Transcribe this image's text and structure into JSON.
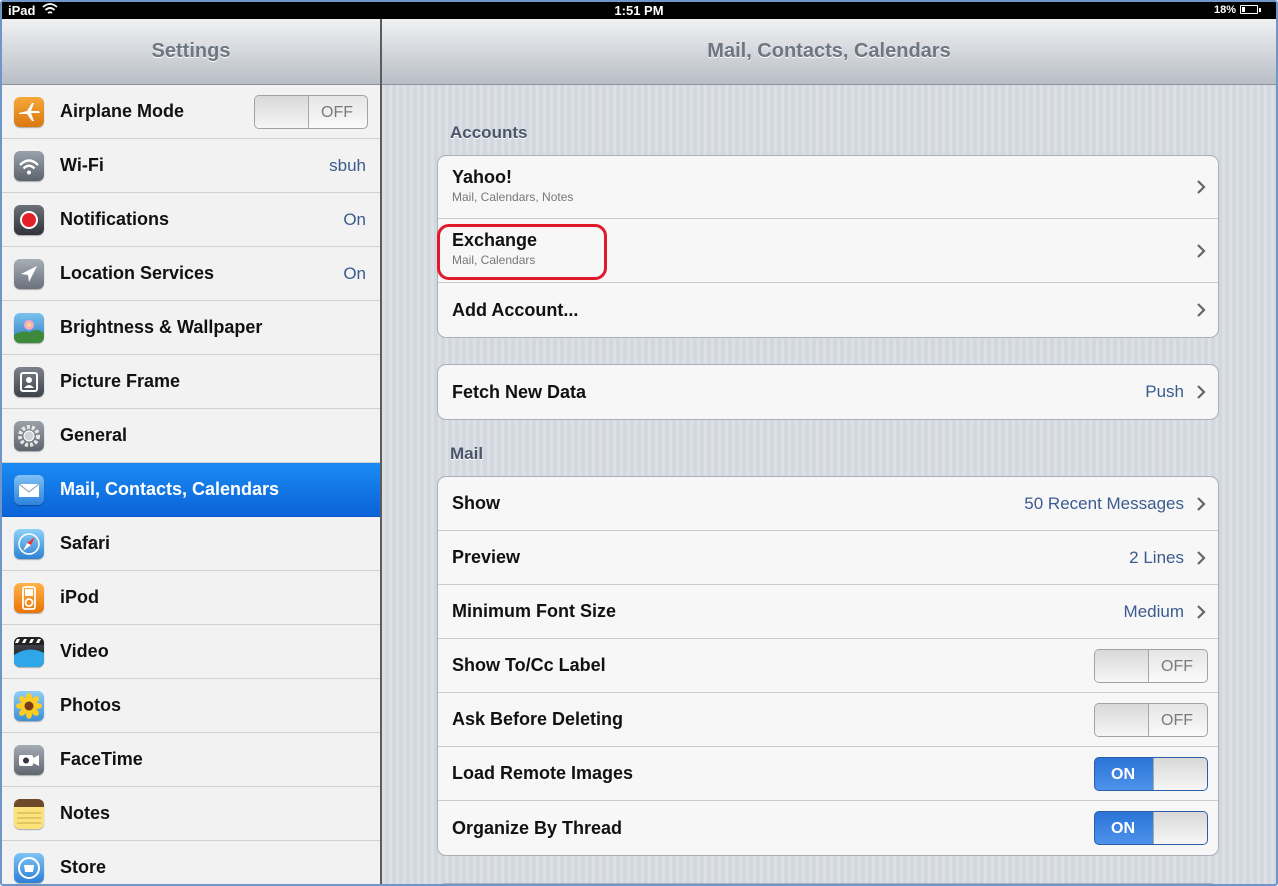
{
  "status_bar": {
    "carrier": "iPad",
    "time": "1:51 PM",
    "battery": "18%"
  },
  "sidebar": {
    "title": "Settings",
    "items": [
      {
        "label": "Airplane Mode",
        "icon": "airplane-icon",
        "toggle": "OFF"
      },
      {
        "label": "Wi-Fi",
        "icon": "wifi-icon",
        "value": "sbuh"
      },
      {
        "label": "Notifications",
        "icon": "notifications-icon",
        "value": "On"
      },
      {
        "label": "Location Services",
        "icon": "location-icon",
        "value": "On"
      },
      {
        "label": "Brightness & Wallpaper",
        "icon": "brightness-wallpaper-icon"
      },
      {
        "label": "Picture Frame",
        "icon": "picture-frame-icon"
      },
      {
        "label": "General",
        "icon": "gear-icon"
      },
      {
        "label": "Mail, Contacts, Calendars",
        "icon": "mail-icon",
        "selected": true
      },
      {
        "label": "Safari",
        "icon": "safari-compass-icon"
      },
      {
        "label": "iPod",
        "icon": "ipod-icon"
      },
      {
        "label": "Video",
        "icon": "video-clapper-icon"
      },
      {
        "label": "Photos",
        "icon": "photos-sunflower-icon"
      },
      {
        "label": "FaceTime",
        "icon": "facetime-camera-icon"
      },
      {
        "label": "Notes",
        "icon": "notes-icon"
      },
      {
        "label": "Store",
        "icon": "store-icon"
      }
    ]
  },
  "detail": {
    "title": "Mail, Contacts, Calendars",
    "accounts_header": "Accounts",
    "accounts": [
      {
        "label": "Yahoo!",
        "sub": "Mail, Calendars, Notes"
      },
      {
        "label": "Exchange",
        "sub": "Mail, Calendars"
      },
      {
        "label": "Add Account..."
      }
    ],
    "fetch": {
      "label": "Fetch New Data",
      "value": "Push"
    },
    "mail_header": "Mail",
    "mail_rows": [
      {
        "label": "Show",
        "value": "50 Recent Messages"
      },
      {
        "label": "Preview",
        "value": "2 Lines"
      },
      {
        "label": "Minimum Font Size",
        "value": "Medium"
      },
      {
        "label": "Show To/Cc Label",
        "toggle": "OFF"
      },
      {
        "label": "Ask Before Deleting",
        "toggle": "OFF"
      },
      {
        "label": "Load Remote Images",
        "toggle": "ON"
      },
      {
        "label": "Organize By Thread",
        "toggle": "ON"
      }
    ]
  },
  "colors": {
    "selection_blue": "#0b63d8",
    "value_text": "#3b5b8e",
    "highlight_red": "#e0192b",
    "toggle_on_blue": "#2b73d6"
  }
}
